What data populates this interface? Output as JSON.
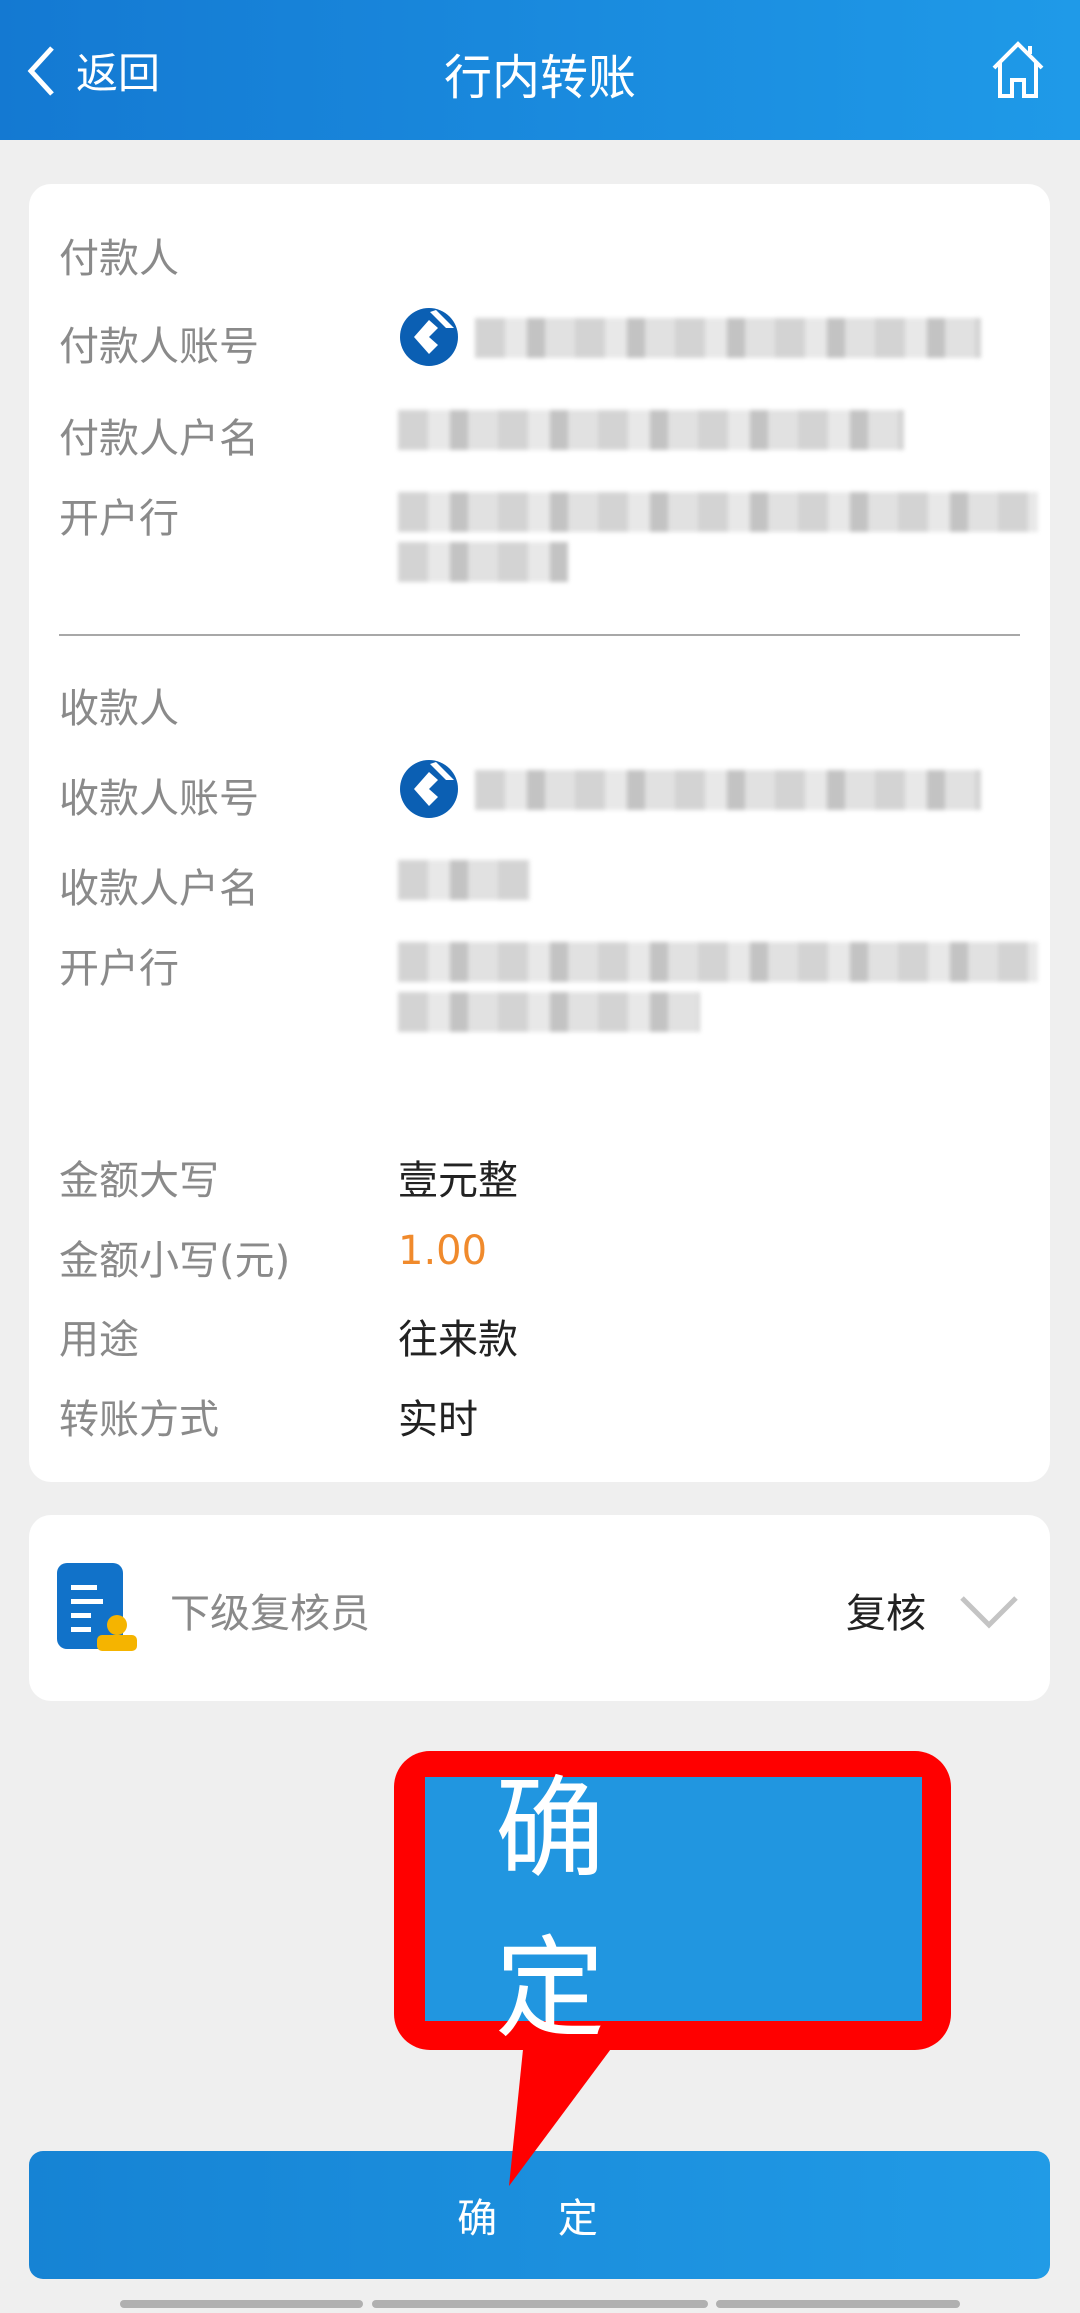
{
  "header": {
    "back_label": "返回",
    "title": "行内转账",
    "home_icon": "home-icon"
  },
  "payer": {
    "section": "付款人",
    "account_label": "付款人账号",
    "name_label": "付款人户名",
    "bank_label": "开户行"
  },
  "payee": {
    "section": "收款人",
    "account_label": "收款人账号",
    "name_label": "收款人户名",
    "bank_label": "开户行"
  },
  "amount": {
    "upper_label": "金额大写",
    "upper_value": "壹元整",
    "lower_label": "金额小写(元)",
    "lower_value": "1.00",
    "purpose_label": "用途",
    "purpose_value": "往来款",
    "method_label": "转账方式",
    "method_value": "实时"
  },
  "reviewer": {
    "label": "下级复核员",
    "value": "复核"
  },
  "confirm_label": "确 定",
  "callout_label": "确 定",
  "colors": {
    "accent": "#1f8fe0",
    "amount": "#f08a2c",
    "highlight": "#ff0000"
  }
}
